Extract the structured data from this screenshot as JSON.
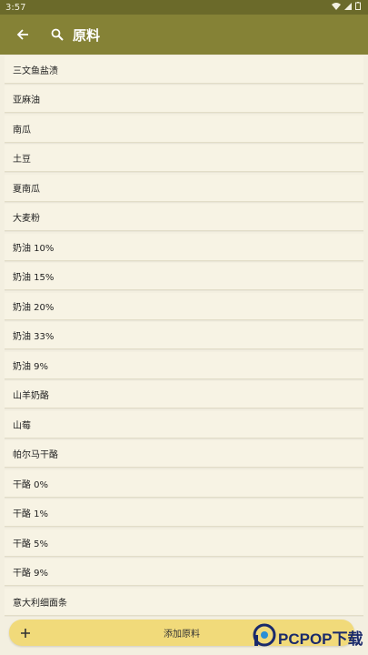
{
  "status": {
    "time": "3:57"
  },
  "appbar": {
    "title": "原料"
  },
  "items": [
    "三文鱼盐渍",
    "亚麻油",
    "南瓜",
    "土豆",
    "夏南瓜",
    "大麦粉",
    "奶油 10%",
    "奶油 15%",
    "奶油 20%",
    "奶油 33%",
    "奶油 9%",
    "山羊奶酪",
    "山莓",
    "帕尔马干酪",
    "干酪 0%",
    "干酪 1%",
    "干酪 5%",
    "干酪 9%",
    "意大利细面条"
  ],
  "fab": {
    "label": "添加原料"
  },
  "watermark": {
    "text": "PCPOP下载"
  },
  "colors": {
    "appbar": "#858236",
    "statusbar": "#6b6a2a",
    "fab": "#f1da7a",
    "background": "#f3efe0"
  }
}
